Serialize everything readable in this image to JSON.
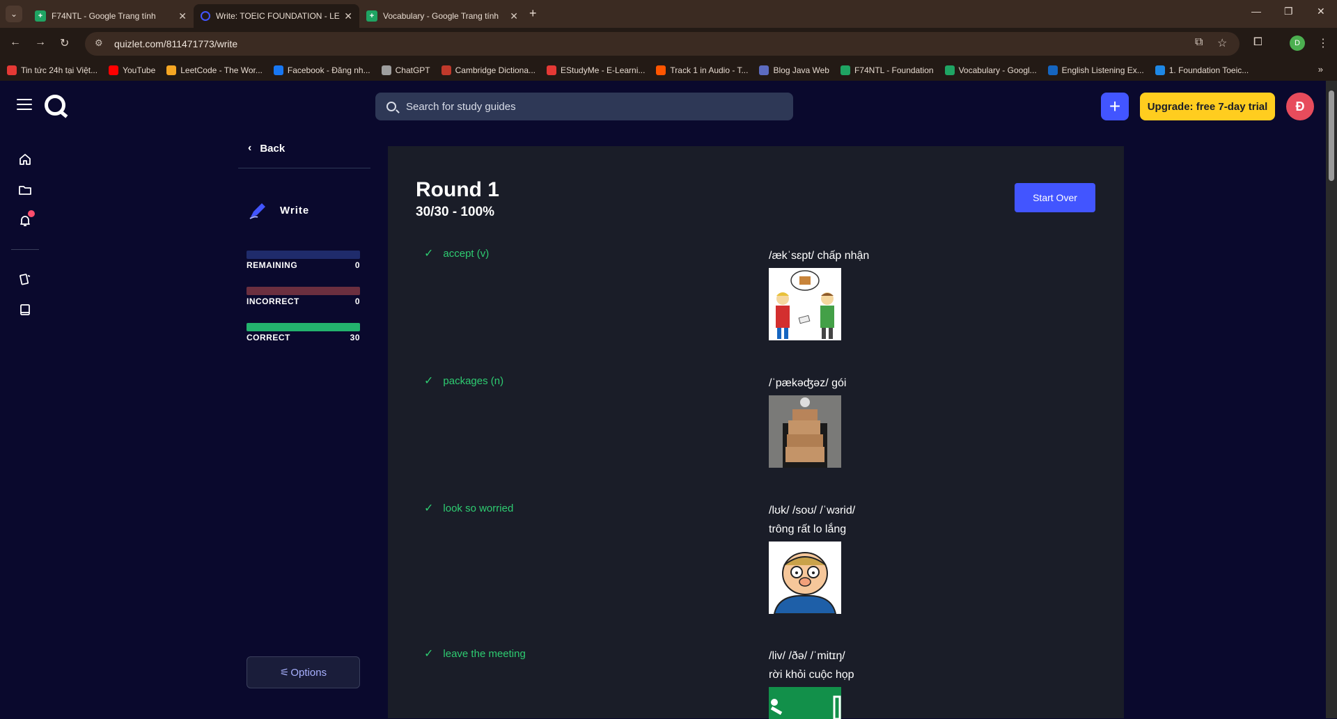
{
  "browser": {
    "tabs": [
      {
        "title": "F74NTL - Google Trang tính",
        "icon": "sheets-icon",
        "active": false
      },
      {
        "title": "Write: TOEIC FOUNDATION - LE",
        "icon": "quizlet-icon",
        "active": true
      },
      {
        "title": "Vocabulary - Google Trang tính",
        "icon": "sheets-icon",
        "active": false
      }
    ],
    "url": "quizlet.com/811471773/write",
    "profile_initial": "D",
    "bookmarks": [
      {
        "label": "Tin tức 24h tại Việt...",
        "color": "#e53935"
      },
      {
        "label": "YouTube",
        "color": "#ff0000"
      },
      {
        "label": "LeetCode - The Wor...",
        "color": "#f5a623"
      },
      {
        "label": "Facebook - Đăng nh...",
        "color": "#1877f2"
      },
      {
        "label": "ChatGPT",
        "color": "#9e9e9e"
      },
      {
        "label": "Cambridge Dictiona...",
        "color": "#c0392b"
      },
      {
        "label": "EStudyMe - E-Learni...",
        "color": "#e53935"
      },
      {
        "label": "Track 1 in Audio - T...",
        "color": "#ff5500"
      },
      {
        "label": "Blog Java Web",
        "color": "#5c6bc0"
      },
      {
        "label": "F74NTL - Foundation",
        "color": "#1fa463"
      },
      {
        "label": "Vocabulary - Googl...",
        "color": "#1fa463"
      },
      {
        "label": "English Listening Ex...",
        "color": "#1565c0"
      },
      {
        "label": "1. Foundation Toeic...",
        "color": "#1e88e5"
      }
    ]
  },
  "header": {
    "search_placeholder": "Search for study guides",
    "plus_label": "+",
    "upgrade_label": "Upgrade: free 7-day trial",
    "avatar_initial": "Đ"
  },
  "left": {
    "back_label": "Back",
    "mode_label": "Write",
    "stats": [
      {
        "label": "REMAINING",
        "value": "0",
        "color": "#1f2b6b"
      },
      {
        "label": "INCORRECT",
        "value": "0",
        "color": "#6b2f3f"
      },
      {
        "label": "CORRECT",
        "value": "30",
        "color": "#23b26d"
      }
    ],
    "options_label": "Options"
  },
  "main": {
    "round_title": "Round 1",
    "score": "30/30 - 100%",
    "start_over_label": "Start Over",
    "items": [
      {
        "term": "accept (v)",
        "def_line1": "/ækˈsɛpt/ chấp nhận",
        "def_line2": "",
        "image": "accept-illustration"
      },
      {
        "term": "packages (n)",
        "def_line1": "/ˈpækəʤəz/ gói",
        "def_line2": "",
        "image": "packages-photo"
      },
      {
        "term": "look so worried",
        "def_line1": "/lʊk/ /soʊ/ /ˈwɜrid/",
        "def_line2": "trông rất lo lắng",
        "image": "worried-man-cartoon"
      },
      {
        "term": "leave the meeting",
        "def_line1": "/liv/ /ðə/ /ˈmitɪŋ/",
        "def_line2": "rời khỏi cuộc họp",
        "image": "exit-sign"
      }
    ]
  }
}
